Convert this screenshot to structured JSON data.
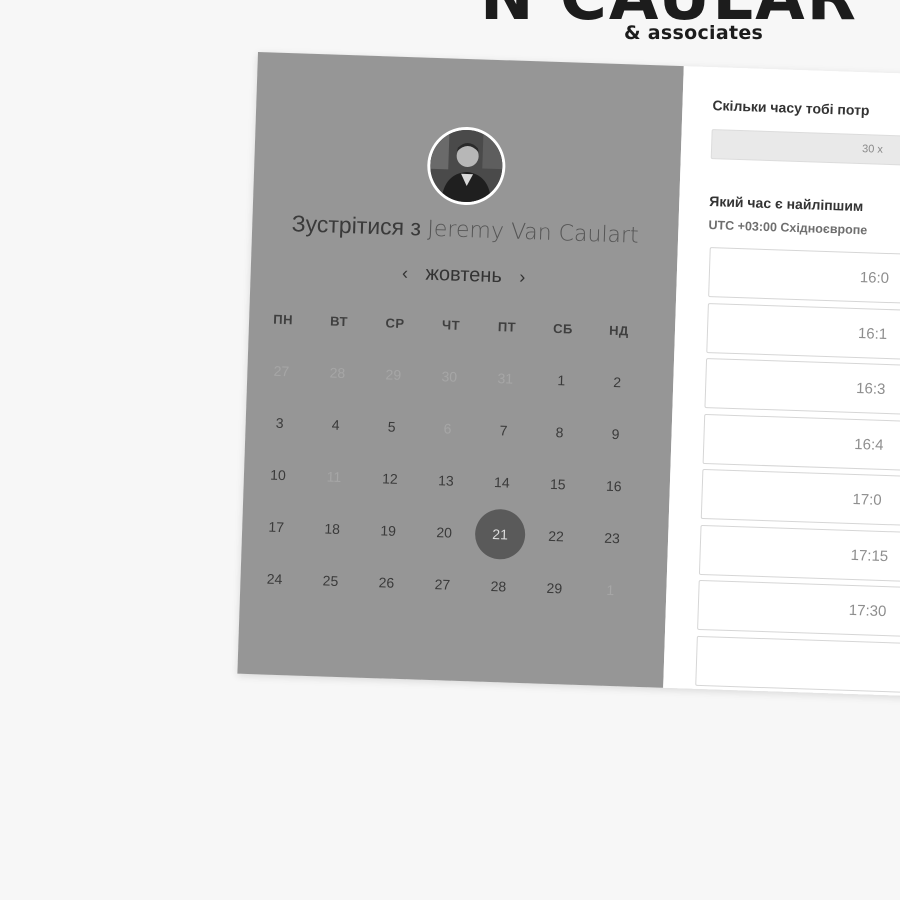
{
  "brand": {
    "title_partial": "N CAULAR",
    "subtitle": "& associates"
  },
  "booking": {
    "meet_prefix": "Зустрітися з",
    "host_name": "Jeremy Van Caulart",
    "month": "жовтень",
    "prev_icon": "chevron-left-icon",
    "next_icon": "chevron-right-icon",
    "weekdays": [
      "ПН",
      "ВТ",
      "СР",
      "ЧТ",
      "ПТ",
      "СБ",
      "НД"
    ],
    "weeks": [
      [
        {
          "d": "27",
          "s": "dim"
        },
        {
          "d": "28",
          "s": "dim"
        },
        {
          "d": "29",
          "s": "dim"
        },
        {
          "d": "30",
          "s": "dim"
        },
        {
          "d": "31",
          "s": "dim"
        },
        {
          "d": "1",
          "s": ""
        },
        {
          "d": "2",
          "s": ""
        }
      ],
      [
        {
          "d": "3",
          "s": ""
        },
        {
          "d": "4",
          "s": ""
        },
        {
          "d": "5",
          "s": ""
        },
        {
          "d": "6",
          "s": "dim"
        },
        {
          "d": "7",
          "s": ""
        },
        {
          "d": "8",
          "s": ""
        },
        {
          "d": "9",
          "s": ""
        }
      ],
      [
        {
          "d": "10",
          "s": ""
        },
        {
          "d": "11",
          "s": "dim"
        },
        {
          "d": "12",
          "s": ""
        },
        {
          "d": "13",
          "s": ""
        },
        {
          "d": "14",
          "s": ""
        },
        {
          "d": "15",
          "s": ""
        },
        {
          "d": "16",
          "s": ""
        }
      ],
      [
        {
          "d": "17",
          "s": ""
        },
        {
          "d": "18",
          "s": ""
        },
        {
          "d": "19",
          "s": ""
        },
        {
          "d": "20",
          "s": ""
        },
        {
          "d": "21",
          "s": "sel"
        },
        {
          "d": "22",
          "s": ""
        },
        {
          "d": "23",
          "s": ""
        }
      ],
      [
        {
          "d": "24",
          "s": ""
        },
        {
          "d": "25",
          "s": ""
        },
        {
          "d": "26",
          "s": ""
        },
        {
          "d": "27",
          "s": ""
        },
        {
          "d": "28",
          "s": ""
        },
        {
          "d": "29",
          "s": ""
        },
        {
          "d": "1",
          "s": "dim"
        }
      ]
    ],
    "selected_day": "21"
  },
  "scheduler": {
    "duration_question": "Скільки часу тобі потр",
    "duration_value": "30 х",
    "time_question": "Який час є найліпшим",
    "timezone": "UTC +03:00 Східноєвропе",
    "slots": [
      "16:0",
      "16:1",
      "16:3",
      "16:4",
      "17:0",
      "17:15",
      "17:30",
      ""
    ]
  },
  "colors": {
    "page_bg": "#f7f7f7",
    "calendar_panel": "#969696",
    "selected_day_bg": "#5a5a5a",
    "slots_panel": "#ffffff"
  }
}
